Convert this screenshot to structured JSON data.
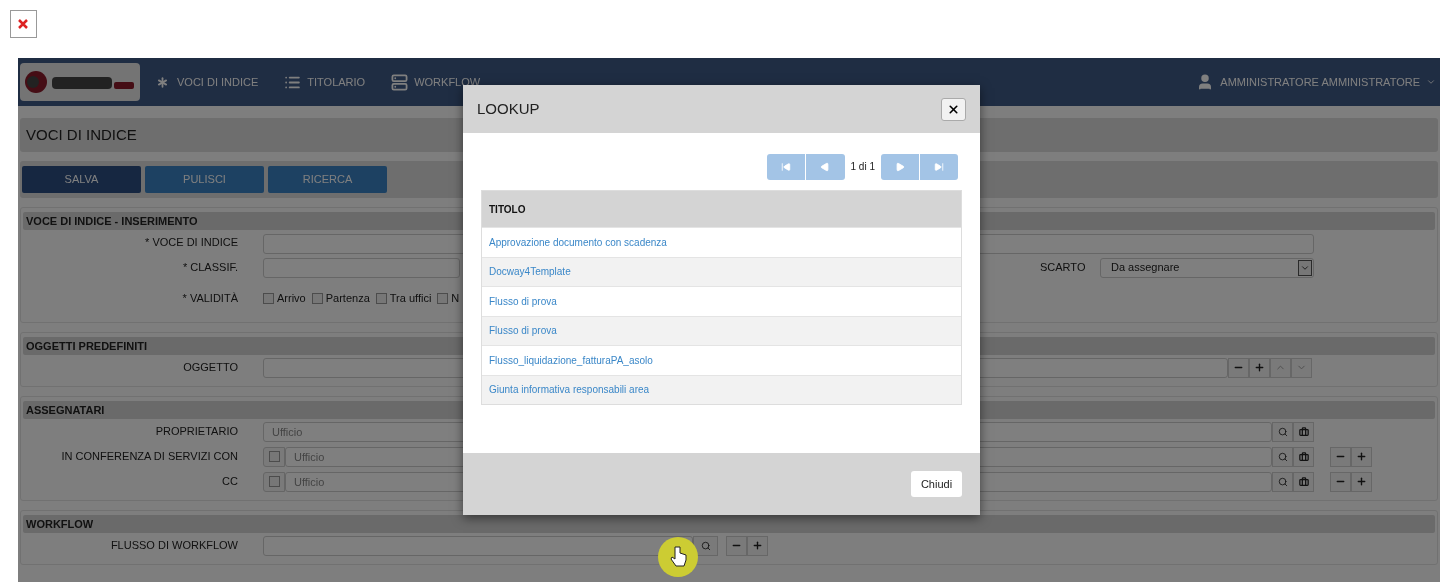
{
  "navbar": {
    "items": [
      {
        "label": "VOCI DI INDICE"
      },
      {
        "label": "TITOLARIO"
      },
      {
        "label": "WORKFLOW"
      }
    ],
    "user": "AMMINISTRATORE AMMINISTRATORE"
  },
  "page_title": "VOCI DI INDICE",
  "toolbar": [
    {
      "label": "SALVA",
      "selected": true
    },
    {
      "label": "PULISCI",
      "selected": false
    },
    {
      "label": "RICERCA",
      "selected": false
    }
  ],
  "sections": [
    {
      "title": "VOCE DI INDICE - INSERIMENTO",
      "rows": [
        {
          "kind": "text",
          "label": "* VOCE DI INDICE"
        },
        {
          "kind": "classif",
          "label": "* CLASSIF.",
          "extra_label": "SCARTO",
          "select_value": "Da assegnare"
        },
        {
          "kind": "checkboxes",
          "label": "* VALIDITÀ",
          "options": [
            {
              "label": "Arrivo",
              "checked": false
            },
            {
              "label": "Partenza",
              "checked": false
            },
            {
              "label": "Tra uffici",
              "checked": false
            },
            {
              "label": "N",
              "checked": false
            }
          ]
        }
      ]
    },
    {
      "title": "OGGETTI PREDEFINITI",
      "rows": [
        {
          "kind": "ordered",
          "label": "OGGETTO"
        }
      ]
    },
    {
      "title": "ASSEGNATARI",
      "rows": [
        {
          "kind": "lookup",
          "label": "PROPRIETARIO",
          "placeholder": "Ufficio"
        },
        {
          "kind": "lookup_multi",
          "label": "IN CONFERENZA DI SERVIZI CON",
          "placeholder": "Ufficio",
          "checked": false
        },
        {
          "kind": "lookup_multi",
          "label": "CC",
          "placeholder": "Ufficio",
          "checked": false
        }
      ]
    },
    {
      "title": "WORKFLOW",
      "rows": [
        {
          "kind": "search",
          "label": "FLUSSO DI WORKFLOW"
        }
      ]
    }
  ],
  "modal": {
    "title": "LOOKUP",
    "pager": "1 di 1",
    "column": "TITOLO",
    "rows": [
      "Approvazione documento con scadenza",
      "Docway4Template",
      "Flusso di prova",
      "Flusso di prova",
      "Flusso_liquidazione_fatturaPA_asolo",
      "Giunta informativa responsabili area"
    ],
    "close_button": "Chiudi"
  }
}
